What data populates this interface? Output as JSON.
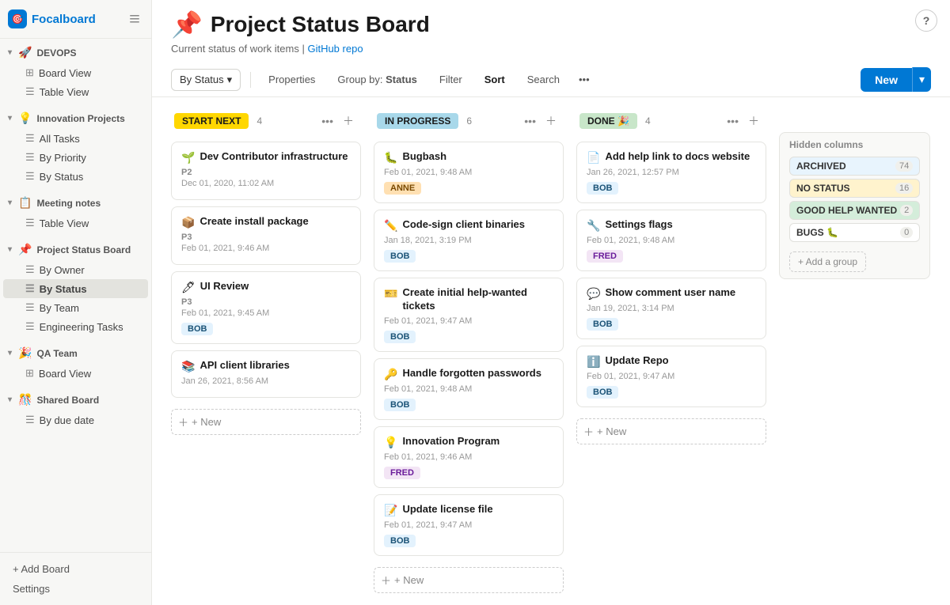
{
  "app": {
    "logo_text": "Focalboard",
    "logo_icon": "🎯",
    "help_label": "?"
  },
  "sidebar": {
    "sections": [
      {
        "id": "devops",
        "emoji": "🚀",
        "label": "DEVOPS",
        "items": [
          {
            "id": "board-view-devops",
            "icon": "⊞",
            "label": "Board View"
          },
          {
            "id": "table-view-devops",
            "icon": "☰",
            "label": "Table View"
          }
        ]
      },
      {
        "id": "innovation",
        "emoji": "💡",
        "label": "Innovation Projects",
        "items": [
          {
            "id": "all-tasks",
            "icon": "☰",
            "label": "All Tasks"
          },
          {
            "id": "by-priority",
            "icon": "☰",
            "label": "By Priority"
          },
          {
            "id": "by-status-innovation",
            "icon": "☰",
            "label": "By Status"
          }
        ]
      },
      {
        "id": "meeting-notes",
        "emoji": "📋",
        "label": "Meeting notes",
        "items": [
          {
            "id": "table-view-meeting",
            "icon": "☰",
            "label": "Table View"
          }
        ]
      },
      {
        "id": "project-status",
        "emoji": "📌",
        "label": "Project Status Board",
        "active": true,
        "items": [
          {
            "id": "by-owner",
            "icon": "☰",
            "label": "By Owner"
          },
          {
            "id": "by-status-project",
            "icon": "☰",
            "label": "By Status",
            "active": true
          },
          {
            "id": "by-team",
            "icon": "☰",
            "label": "By Team"
          },
          {
            "id": "engineering-tasks",
            "icon": "☰",
            "label": "Engineering Tasks"
          }
        ]
      },
      {
        "id": "qa-team",
        "emoji": "🎉",
        "label": "QA Team",
        "items": [
          {
            "id": "board-view-qa",
            "icon": "⊞",
            "label": "Board View"
          }
        ]
      },
      {
        "id": "shared-board",
        "emoji": "🎊",
        "label": "Shared Board",
        "items": [
          {
            "id": "by-due-date",
            "icon": "☰",
            "label": "By due date"
          }
        ]
      }
    ],
    "add_board": "+ Add Board",
    "settings": "Settings"
  },
  "page": {
    "emoji": "📌",
    "title": "Project Status Board",
    "subtitle_text": "Current status of work items |",
    "subtitle_link": "GitHub repo"
  },
  "toolbar": {
    "group_by_label": "By Status",
    "group_by_icon": "▾",
    "properties_label": "Properties",
    "group_by_prefix": "Group by:",
    "group_by_value": "Status",
    "filter_label": "Filter",
    "sort_label": "Sort",
    "search_label": "Search",
    "more_icon": "•••",
    "new_label": "New",
    "new_arrow": "▾"
  },
  "columns": [
    {
      "id": "start-next",
      "label": "START NEXT",
      "badge_class": "column-badge-start",
      "count": 4,
      "cards": [
        {
          "icon": "🌱",
          "title": "Dev Contributor infrastructure",
          "priority": "P2",
          "date": "Dec 01, 2020, 11:02 AM",
          "assignee": "",
          "assignee_class": ""
        },
        {
          "icon": "📦",
          "title": "Create install package",
          "priority": "P3",
          "date": "Feb 01, 2021, 9:46 AM",
          "assignee": "",
          "assignee_class": ""
        },
        {
          "icon": "🖊",
          "title": "UI Review",
          "priority": "P3",
          "date": "Feb 01, 2021, 9:45 AM",
          "assignee": "BOB",
          "assignee_class": "assignee-bob"
        },
        {
          "icon": "📚",
          "title": "API client libraries",
          "priority": "",
          "date": "Jan 26, 2021, 8:56 AM",
          "assignee": "",
          "assignee_class": ""
        }
      ],
      "add_label": "+ New"
    },
    {
      "id": "in-progress",
      "label": "IN PROGRESS",
      "badge_class": "column-badge-inprogress",
      "count": 6,
      "cards": [
        {
          "icon": "🐛",
          "title": "Bugbash",
          "priority": "",
          "date": "Feb 01, 2021, 9:48 AM",
          "assignee": "ANNE",
          "assignee_class": "assignee-anne"
        },
        {
          "icon": "✏️",
          "title": "Code-sign client binaries",
          "priority": "",
          "date": "Jan 18, 2021, 3:19 PM",
          "assignee": "BOB",
          "assignee_class": "assignee-bob"
        },
        {
          "icon": "🎫",
          "title": "Create initial help-wanted tickets",
          "priority": "",
          "date": "Feb 01, 2021, 9:47 AM",
          "assignee": "BOB",
          "assignee_class": "assignee-bob"
        },
        {
          "icon": "🔑",
          "title": "Handle forgotten passwords",
          "priority": "",
          "date": "Feb 01, 2021, 9:48 AM",
          "assignee": "BOB",
          "assignee_class": "assignee-bob"
        },
        {
          "icon": "💡",
          "title": "Innovation Program",
          "priority": "",
          "date": "Feb 01, 2021, 9:46 AM",
          "assignee": "FRED",
          "assignee_class": "assignee-fred"
        },
        {
          "icon": "📝",
          "title": "Update license file",
          "priority": "",
          "date": "Feb 01, 2021, 9:47 AM",
          "assignee": "BOB",
          "assignee_class": "assignee-bob"
        }
      ],
      "add_label": "+ New"
    },
    {
      "id": "done",
      "label": "DONE 🎉",
      "badge_class": "column-badge-done",
      "count": 4,
      "cards": [
        {
          "icon": "📄",
          "title": "Add help link to docs website",
          "priority": "",
          "date": "Jan 26, 2021, 12:57 PM",
          "assignee": "BOB",
          "assignee_class": "assignee-bob"
        },
        {
          "icon": "🔧",
          "title": "Settings flags",
          "priority": "",
          "date": "Feb 01, 2021, 9:48 AM",
          "assignee": "FRED",
          "assignee_class": "assignee-fred"
        },
        {
          "icon": "💬",
          "title": "Show comment user name",
          "priority": "",
          "date": "Jan 19, 2021, 3:14 PM",
          "assignee": "BOB",
          "assignee_class": "assignee-bob"
        },
        {
          "icon": "ℹ️",
          "title": "Update Repo",
          "priority": "",
          "date": "Feb 01, 2021, 9:47 AM",
          "assignee": "BOB",
          "assignee_class": "assignee-bob"
        }
      ],
      "add_label": "+ New"
    }
  ],
  "hidden_columns": {
    "title": "Hidden columns",
    "items": [
      {
        "id": "archived",
        "label": "ARCHIVED",
        "count": 74
      },
      {
        "id": "no-status",
        "label": "NO STATUS",
        "count": 16
      },
      {
        "id": "good-help-wanted",
        "label": "GOOD HELP WANTED",
        "count": 2
      },
      {
        "id": "bugs",
        "label": "BUGS 🐛",
        "count": 0
      }
    ],
    "add_group_label": "+ Add a group"
  }
}
